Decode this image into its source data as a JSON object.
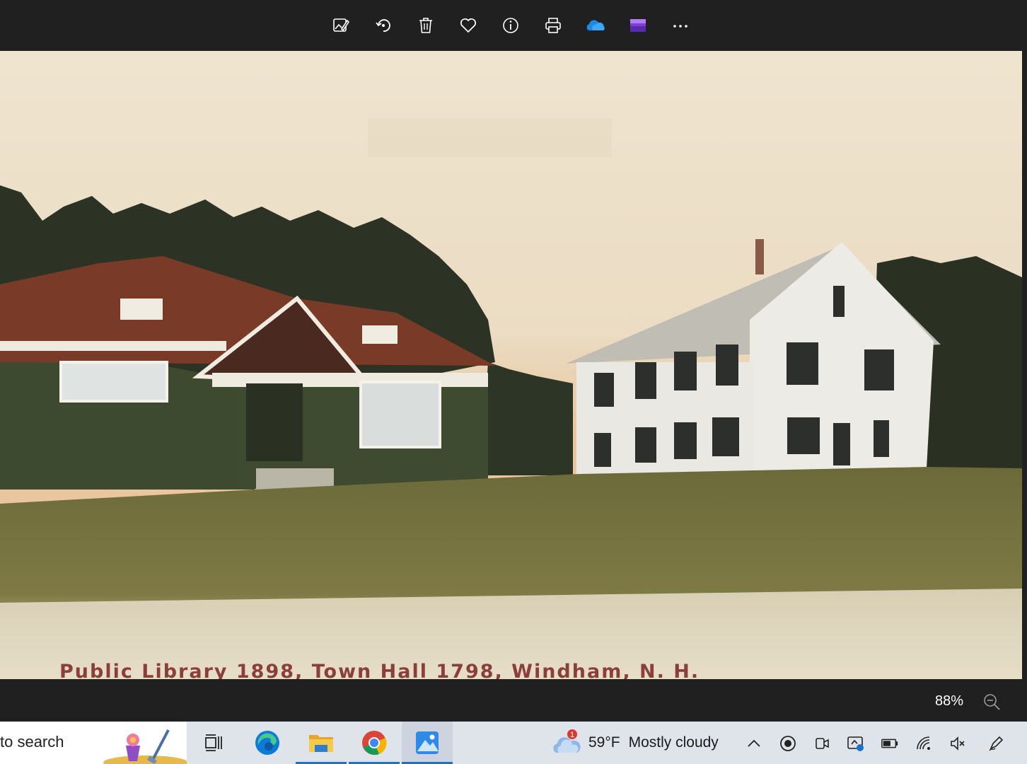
{
  "viewer": {
    "toolbar": {
      "buttons": [
        {
          "name": "edit-image-button",
          "icon": "edit-image-icon"
        },
        {
          "name": "rotate-button",
          "icon": "rotate-icon"
        },
        {
          "name": "delete-button",
          "icon": "trash-icon"
        },
        {
          "name": "favorite-button",
          "icon": "heart-icon"
        },
        {
          "name": "info-button",
          "icon": "info-icon"
        },
        {
          "name": "print-button",
          "icon": "printer-icon"
        },
        {
          "name": "onedrive-button",
          "icon": "onedrive-cloud-icon"
        },
        {
          "name": "clipchamp-button",
          "icon": "clipchamp-icon"
        },
        {
          "name": "more-options-button",
          "icon": "ellipsis-icon"
        }
      ]
    },
    "photo": {
      "caption": "Public Library 1898, Town Hall 1798, Windham, N. H."
    },
    "status": {
      "zoom_level": "88%",
      "zoom_out_icon": "zoom-out-icon"
    }
  },
  "taskbar": {
    "search_text": "to search",
    "apps": [
      "task-view-icon",
      "edge-icon",
      "file-explorer-icon",
      "chrome-icon",
      "photos-icon"
    ],
    "weather": {
      "badge": "1",
      "temperature": "59°F",
      "condition": "Mostly cloudy"
    },
    "tray_icons": [
      "chevron-up-icon",
      "record-icon",
      "meet-now-icon",
      "screen-capture-icon",
      "battery-icon",
      "wifi-icon",
      "volume-muted-icon",
      "pen-icon"
    ]
  },
  "colors": {
    "toolbar_bg": "#202020",
    "caption_color": "#8a3f3a",
    "taskbar_bg": "#dfe3ea",
    "accent": "#1a73c8"
  }
}
